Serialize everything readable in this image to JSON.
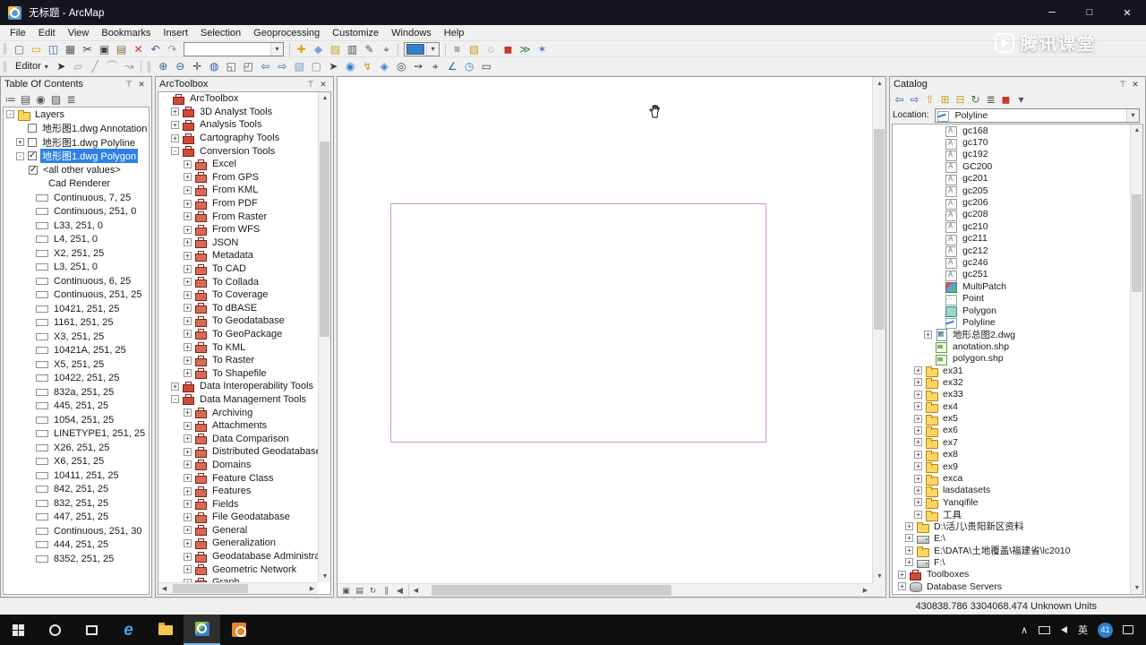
{
  "colors": {
    "selection": "#2e80e8",
    "rect-outline": "#cc99cc",
    "titlebar-bg": "#15151f",
    "taskbar-bg": "#0f0f0f",
    "fill-swatch": "#2f7fd6",
    "badge": "#2e7fd0"
  },
  "window": {
    "title": "无标题 - ArcMap",
    "minimize": "─",
    "maximize": "□",
    "close": "✕"
  },
  "watermark": {
    "text": "腾讯课堂"
  },
  "menu": {
    "items": [
      "File",
      "Edit",
      "View",
      "Bookmarks",
      "Insert",
      "Selection",
      "Geoprocessing",
      "Customize",
      "Windows",
      "Help"
    ]
  },
  "toolbars": {
    "scale_value": "",
    "editor_label": "Editor",
    "editor_caret": "▾",
    "standard_a": [
      {
        "name": "new-map-icon",
        "g": "▢",
        "c": "#5a5a5a"
      },
      {
        "name": "open-icon",
        "g": "▭",
        "c": "#d8a21a"
      },
      {
        "name": "save-icon",
        "g": "◫",
        "c": "#2f5fa8"
      },
      {
        "name": "print-icon",
        "g": "▦",
        "c": "#5a5a5a"
      },
      {
        "name": "cut-icon",
        "g": "✂",
        "c": "#444444"
      },
      {
        "name": "copy-icon",
        "g": "▣",
        "c": "#444444"
      },
      {
        "name": "paste-icon",
        "g": "▤",
        "c": "#8a6d3b"
      },
      {
        "name": "delete-icon",
        "g": "✕",
        "c": "#c23b2e"
      },
      {
        "name": "undo-icon",
        "g": "↶",
        "c": "#2f5fa8"
      },
      {
        "name": "redo-icon",
        "g": "↷",
        "c": "#9a9a9a"
      }
    ],
    "standard_b": [
      {
        "name": "add-data-icon",
        "g": "✚",
        "c": "#d8a21a"
      },
      {
        "name": "add-basemap-icon",
        "g": "◆",
        "c": "#7aa7d8"
      },
      {
        "name": "arccatalog-icon",
        "g": "▨",
        "c": "#caa227"
      },
      {
        "name": "table-options-icon",
        "g": "▥",
        "c": "#555555"
      },
      {
        "name": "editor-toolbar-icon",
        "g": "✎",
        "c": "#555555"
      },
      {
        "name": "snapping-icon",
        "g": "⌖",
        "c": "#555555"
      }
    ],
    "window_icons": [
      {
        "name": "toc-window-icon",
        "g": "≡",
        "c": "#555555"
      },
      {
        "name": "catalog-window-icon",
        "g": "▧",
        "c": "#caa227"
      },
      {
        "name": "search-window-icon",
        "g": "◌",
        "c": "#2f5fa8"
      },
      {
        "name": "arctoolbox-window-icon",
        "g": "◼",
        "c": "#c23b2e"
      },
      {
        "name": "python-window-icon",
        "g": "≫",
        "c": "#3a7a3a"
      },
      {
        "name": "modelbuilder-icon",
        "g": "✶",
        "c": "#4a7ac0"
      }
    ],
    "editor_icons": [
      {
        "name": "edit-tool-icon",
        "g": "➤",
        "c": "#333333"
      },
      {
        "name": "edit-annotation-icon",
        "g": "▱",
        "c": "#9a9a9a"
      },
      {
        "name": "straight-segment-icon",
        "g": "╱",
        "c": "#9a9a9a"
      },
      {
        "name": "arc-segment-icon",
        "g": "⌒",
        "c": "#9a9a9a"
      },
      {
        "name": "trace-icon",
        "g": "↝",
        "c": "#9a9a9a"
      }
    ],
    "tools": [
      {
        "name": "zoom-in-icon",
        "g": "⊕",
        "c": "#2f5fa8"
      },
      {
        "name": "zoom-out-icon",
        "g": "⊖",
        "c": "#2f5fa8"
      },
      {
        "name": "pan-icon",
        "g": "✛",
        "c": "#444444"
      },
      {
        "name": "full-extent-icon",
        "g": "◍",
        "c": "#2f5fa8"
      },
      {
        "name": "fixed-zoom-in-icon",
        "g": "◱",
        "c": "#555555"
      },
      {
        "name": "fixed-zoom-out-icon",
        "g": "◰",
        "c": "#555555"
      },
      {
        "name": "back-extent-icon",
        "g": "⇦",
        "c": "#2f5fa8"
      },
      {
        "name": "forward-extent-icon",
        "g": "⇨",
        "c": "#2f5fa8"
      },
      {
        "name": "select-features-icon",
        "g": "▧",
        "c": "#7a9ac8"
      },
      {
        "name": "clear-selection-icon",
        "g": "▢",
        "c": "#888888"
      },
      {
        "name": "select-elements-icon",
        "g": "➤",
        "c": "#444444"
      },
      {
        "name": "identify-icon",
        "g": "◉",
        "c": "#2f7fd6"
      },
      {
        "name": "hyperlink-icon",
        "g": "↯",
        "c": "#c8a21a"
      },
      {
        "name": "html-popup-icon",
        "g": "◈",
        "c": "#2f7fd6"
      },
      {
        "name": "find-icon",
        "g": "◎",
        "c": "#444444"
      },
      {
        "name": "find-route-icon",
        "g": "➙",
        "c": "#444444"
      },
      {
        "name": "go-to-xy-icon",
        "g": "⌖",
        "c": "#444444"
      },
      {
        "name": "measure-icon",
        "g": "∠",
        "c": "#2f5fa8"
      },
      {
        "name": "time-slider-icon",
        "g": "◷",
        "c": "#2f7fd6"
      },
      {
        "name": "viewer-window-icon",
        "g": "▭",
        "c": "#444444"
      }
    ]
  },
  "toc": {
    "title": "Table Of Contents",
    "tools": [
      {
        "name": "list-by-drawing-order-icon",
        "g": "≔",
        "c": "#555555"
      },
      {
        "name": "list-by-source-icon",
        "g": "▤",
        "c": "#555555"
      },
      {
        "name": "list-by-visibility-icon",
        "g": "◉",
        "c": "#555555"
      },
      {
        "name": "list-by-selection-icon",
        "g": "▨",
        "c": "#555555"
      },
      {
        "name": "options-icon",
        "g": "≣",
        "c": "#555555"
      }
    ],
    "root_expand": "-",
    "root_label": "Layers",
    "layers": [
      {
        "label": "地形图1.dwg Annotation",
        "expand": "",
        "checked": false,
        "selected": false
      },
      {
        "label": "地形图1.dwg Polyline",
        "expand": "+",
        "checked": false,
        "selected": false
      },
      {
        "label": "地形图1.dwg Polygon",
        "expand": "-",
        "checked": true,
        "selected": true
      }
    ],
    "all_other_values": "<all other values>",
    "renderer": "Cad Renderer",
    "legend": [
      "Continuous, 7, 25",
      "Continuous, 251, 0",
      "L33, 251, 0",
      "L4, 251, 0",
      "X2, 251, 25",
      "L3, 251, 0",
      "Continuous, 6, 25",
      "Continuous, 251, 25",
      "10421, 251, 25",
      "1161, 251, 25",
      "X3, 251, 25",
      "10421A, 251, 25",
      "X5, 251, 25",
      "10422, 251, 25",
      "832a, 251, 25",
      "445, 251, 25",
      "1054, 251, 25",
      "LINETYPE1, 251, 25",
      "X26, 251, 25",
      "X6, 251, 25",
      "10411, 251, 25",
      "842, 251, 25",
      "832, 251, 25",
      "447, 251, 25",
      "Continuous, 251, 30",
      "444, 251, 25",
      "8352, 251, 25"
    ]
  },
  "arctoolbox": {
    "title": "ArcToolbox",
    "items": [
      {
        "label": "ArcToolbox",
        "icon": "toolbox",
        "level": 0,
        "expand": ""
      },
      {
        "label": "3D Analyst Tools",
        "icon": "toolbox",
        "level": 1,
        "expand": "+"
      },
      {
        "label": "Analysis Tools",
        "icon": "toolbox",
        "level": 1,
        "expand": "+"
      },
      {
        "label": "Cartography Tools",
        "icon": "toolbox",
        "level": 1,
        "expand": "+"
      },
      {
        "label": "Conversion Tools",
        "icon": "toolbox",
        "level": 1,
        "expand": "-"
      },
      {
        "label": "Excel",
        "icon": "toolset",
        "level": 2,
        "expand": "+"
      },
      {
        "label": "From GPS",
        "icon": "toolset",
        "level": 2,
        "expand": "+"
      },
      {
        "label": "From KML",
        "icon": "toolset",
        "level": 2,
        "expand": "+"
      },
      {
        "label": "From PDF",
        "icon": "toolset",
        "level": 2,
        "expand": "+"
      },
      {
        "label": "From Raster",
        "icon": "toolset",
        "level": 2,
        "expand": "+"
      },
      {
        "label": "From WFS",
        "icon": "toolset",
        "level": 2,
        "expand": "+"
      },
      {
        "label": "JSON",
        "icon": "toolset",
        "level": 2,
        "expand": "+"
      },
      {
        "label": "Metadata",
        "icon": "toolset",
        "level": 2,
        "expand": "+"
      },
      {
        "label": "To CAD",
        "icon": "toolset",
        "level": 2,
        "expand": "+"
      },
      {
        "label": "To Collada",
        "icon": "toolset",
        "level": 2,
        "expand": "+"
      },
      {
        "label": "To Coverage",
        "icon": "toolset",
        "level": 2,
        "expand": "+"
      },
      {
        "label": "To dBASE",
        "icon": "toolset",
        "level": 2,
        "expand": "+"
      },
      {
        "label": "To Geodatabase",
        "icon": "toolset",
        "level": 2,
        "expand": "+"
      },
      {
        "label": "To GeoPackage",
        "icon": "toolset",
        "level": 2,
        "expand": "+"
      },
      {
        "label": "To KML",
        "icon": "toolset",
        "level": 2,
        "expand": "+"
      },
      {
        "label": "To Raster",
        "icon": "toolset",
        "level": 2,
        "expand": "+"
      },
      {
        "label": "To Shapefile",
        "icon": "toolset",
        "level": 2,
        "expand": "+"
      },
      {
        "label": "Data Interoperability Tools",
        "icon": "toolbox",
        "level": 1,
        "expand": "+"
      },
      {
        "label": "Data Management Tools",
        "icon": "toolbox",
        "level": 1,
        "expand": "-"
      },
      {
        "label": "Archiving",
        "icon": "toolset",
        "level": 2,
        "expand": "+"
      },
      {
        "label": "Attachments",
        "icon": "toolset",
        "level": 2,
        "expand": "+"
      },
      {
        "label": "Data Comparison",
        "icon": "toolset",
        "level": 2,
        "expand": "+"
      },
      {
        "label": "Distributed Geodatabase",
        "icon": "toolset",
        "level": 2,
        "expand": "+"
      },
      {
        "label": "Domains",
        "icon": "toolset",
        "level": 2,
        "expand": "+"
      },
      {
        "label": "Feature Class",
        "icon": "toolset",
        "level": 2,
        "expand": "+"
      },
      {
        "label": "Features",
        "icon": "toolset",
        "level": 2,
        "expand": "+"
      },
      {
        "label": "Fields",
        "icon": "toolset",
        "level": 2,
        "expand": "+"
      },
      {
        "label": "File Geodatabase",
        "icon": "toolset",
        "level": 2,
        "expand": "+"
      },
      {
        "label": "General",
        "icon": "toolset",
        "level": 2,
        "expand": "+"
      },
      {
        "label": "Generalization",
        "icon": "toolset",
        "level": 2,
        "expand": "+"
      },
      {
        "label": "Geodatabase Administration",
        "icon": "toolset",
        "level": 2,
        "expand": "+"
      },
      {
        "label": "Geometric Network",
        "icon": "toolset",
        "level": 2,
        "expand": "+"
      },
      {
        "label": "Graph",
        "icon": "toolset",
        "level": 2,
        "expand": "+"
      }
    ]
  },
  "catalog": {
    "title": "Catalog",
    "tools": [
      {
        "name": "back-icon",
        "g": "⇦",
        "c": "#2f5fa8"
      },
      {
        "name": "forward-icon",
        "g": "⇨",
        "c": "#2f5fa8"
      },
      {
        "name": "up-one-level-icon",
        "g": "⇧",
        "c": "#caa227"
      },
      {
        "name": "connect-folder-icon",
        "g": "⊞",
        "c": "#caa227"
      },
      {
        "name": "disconnect-folder-icon",
        "g": "⊟",
        "c": "#caa227"
      },
      {
        "name": "refresh-icon",
        "g": "↻",
        "c": "#2f7f3f"
      },
      {
        "name": "toggle-contents-icon",
        "g": "≣",
        "c": "#555555"
      },
      {
        "name": "launch-arctoolbox-icon",
        "g": "◼",
        "c": "#c23b2e"
      },
      {
        "name": "options-menu-icon",
        "g": "▾",
        "c": "#555555"
      }
    ],
    "location_label": "Location:",
    "location_value": "Polyline",
    "items": [
      {
        "label": "gc168",
        "icon": "anno",
        "level": 5
      },
      {
        "label": "gc170",
        "icon": "anno",
        "level": 5
      },
      {
        "label": "gc192",
        "icon": "anno",
        "level": 5
      },
      {
        "label": "GC200",
        "icon": "anno",
        "level": 5
      },
      {
        "label": "gc201",
        "icon": "anno",
        "level": 5
      },
      {
        "label": "gc205",
        "icon": "anno",
        "level": 5
      },
      {
        "label": "gc206",
        "icon": "anno",
        "level": 5
      },
      {
        "label": "gc208",
        "icon": "anno",
        "level": 5
      },
      {
        "label": "gc210",
        "icon": "anno",
        "level": 5
      },
      {
        "label": "gc211",
        "icon": "anno",
        "level": 5
      },
      {
        "label": "gc212",
        "icon": "anno",
        "level": 5
      },
      {
        "label": "gc246",
        "icon": "anno",
        "level": 5
      },
      {
        "label": "gc251",
        "icon": "anno",
        "level": 5
      },
      {
        "label": "MultiPatch",
        "icon": "multipatch",
        "level": 5
      },
      {
        "label": "Point",
        "icon": "point",
        "level": 5
      },
      {
        "label": "Polygon",
        "icon": "polygon",
        "level": 5
      },
      {
        "label": "Polyline",
        "icon": "polyline",
        "level": 5
      },
      {
        "label": "地形总图2.dwg",
        "icon": "dwg",
        "level": 4,
        "expand": "+"
      },
      {
        "label": "anotation.shp",
        "icon": "shp",
        "level": 4
      },
      {
        "label": "polygon.shp",
        "icon": "shp",
        "level": 4
      },
      {
        "label": "ex31",
        "icon": "folder",
        "level": 3,
        "expand": "+"
      },
      {
        "label": "ex32",
        "icon": "folder",
        "level": 3,
        "expand": "+"
      },
      {
        "label": "ex33",
        "icon": "folder",
        "level": 3,
        "expand": "+"
      },
      {
        "label": "ex4",
        "icon": "folder",
        "level": 3,
        "expand": "+"
      },
      {
        "label": "ex5",
        "icon": "folder",
        "level": 3,
        "expand": "+"
      },
      {
        "label": "ex6",
        "icon": "folder",
        "level": 3,
        "expand": "+"
      },
      {
        "label": "ex7",
        "icon": "folder",
        "level": 3,
        "expand": "+"
      },
      {
        "label": "ex8",
        "icon": "folder",
        "level": 3,
        "expand": "+"
      },
      {
        "label": "ex9",
        "icon": "folder",
        "level": 3,
        "expand": "+"
      },
      {
        "label": "exca",
        "icon": "folder",
        "level": 3,
        "expand": "+"
      },
      {
        "label": "lasdatasets",
        "icon": "folder",
        "level": 3,
        "expand": "+"
      },
      {
        "label": "Yanqifile",
        "icon": "folder",
        "level": 3,
        "expand": "+"
      },
      {
        "label": "工具",
        "icon": "folder",
        "level": 3,
        "expand": "+"
      },
      {
        "label": "D:\\活儿\\贵阳新区资料",
        "icon": "folder",
        "level": 2,
        "expand": "+"
      },
      {
        "label": "E:\\",
        "icon": "drive",
        "level": 2,
        "expand": "+"
      },
      {
        "label": "E:\\DATA\\土地覆盖\\福建省\\lc2010",
        "icon": "folder",
        "level": 2,
        "expand": "+"
      },
      {
        "label": "F:\\",
        "icon": "drive",
        "level": 2,
        "expand": "+"
      },
      {
        "label": "Toolboxes",
        "icon": "toolbox",
        "level": 1,
        "expand": "+"
      },
      {
        "label": "Database Servers",
        "icon": "db",
        "level": 1,
        "expand": "+"
      }
    ]
  },
  "map": {
    "view_buttons": [
      {
        "name": "data-view-button",
        "g": "▣",
        "c": "#555555"
      },
      {
        "name": "layout-view-button",
        "g": "▤",
        "c": "#555555"
      },
      {
        "name": "refresh-view-button",
        "g": "↻",
        "c": "#555555"
      },
      {
        "name": "pause-drawing-button",
        "g": "∥",
        "c": "#555555"
      },
      {
        "name": "pause-labels-button",
        "g": "◀",
        "c": "#555555"
      }
    ]
  },
  "statusbar": {
    "coordinates": "430838.786  3304068.474 Unknown Units"
  },
  "taskbar": {
    "chevron": "∧",
    "input": "英",
    "badge": "41"
  }
}
